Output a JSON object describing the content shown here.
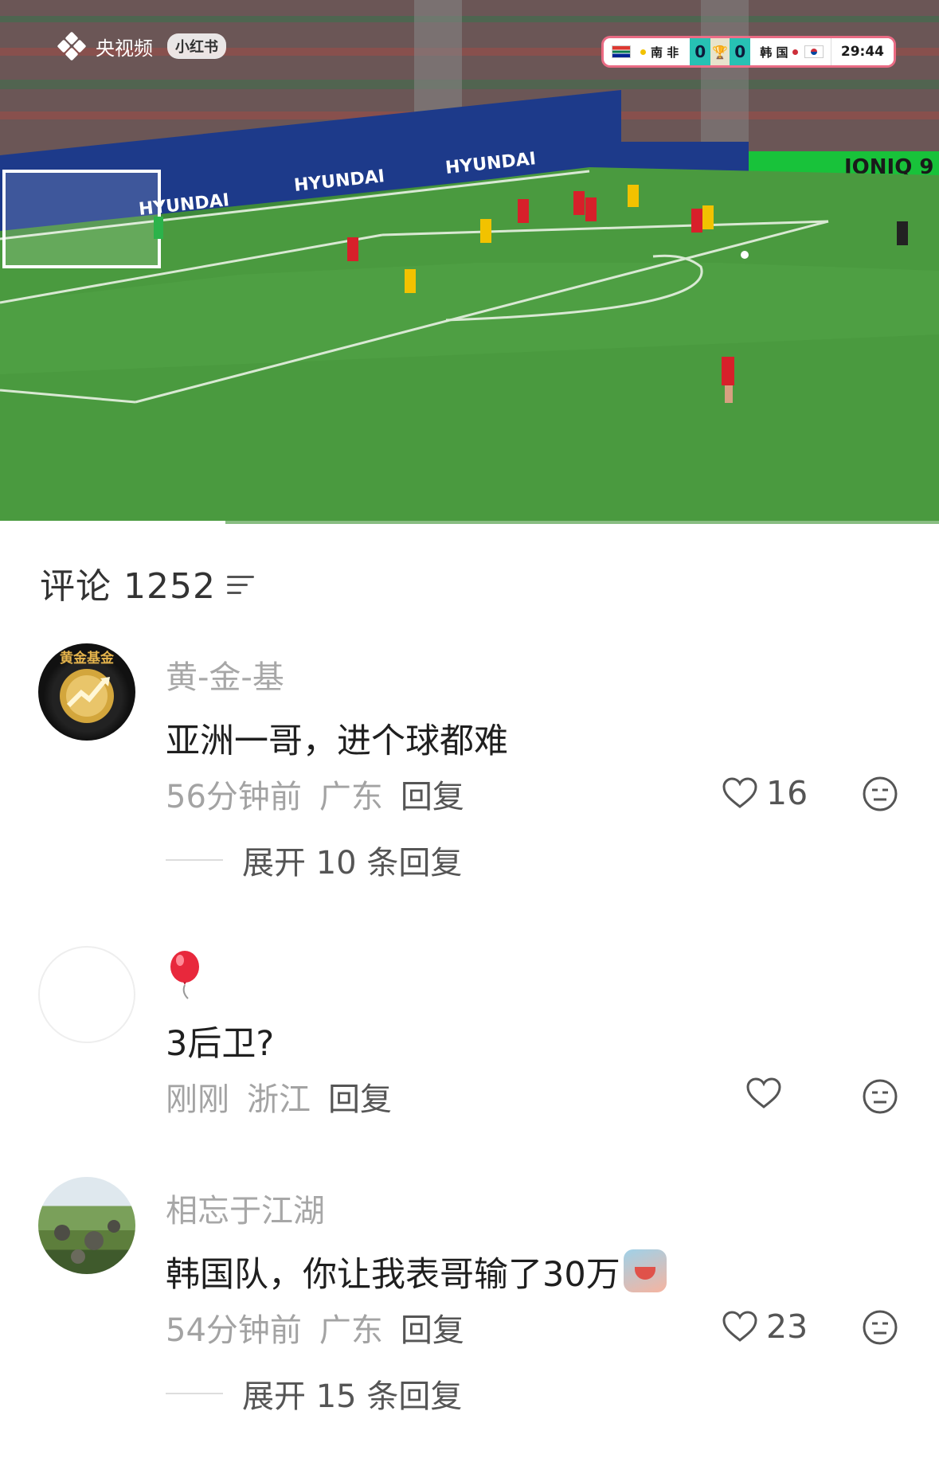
{
  "video": {
    "watermark_brand": "央视频",
    "watermark_app": "小红书",
    "ads": [
      "HYUNDAI",
      "HYUNDAI",
      "HYUNDAI",
      "IONIQ 9"
    ],
    "scoreboard": {
      "home_team": "南 非",
      "home_score": "0",
      "away_team": "韩 国",
      "away_score": "0",
      "clock": "29:44",
      "home_color": "#f2c200",
      "away_color": "#cd2e3a"
    },
    "progress": 0.24
  },
  "comments_header": {
    "title": "评论 1252"
  },
  "comments": [
    {
      "avatar_text": "黄金基金",
      "username": "黄-金-基",
      "text": "亚洲一哥，进个球都难",
      "time": "56分钟前",
      "location": "广东",
      "reply_label": "回复",
      "likes": "16",
      "expand_label": "展开 10 条回复"
    },
    {
      "username_icon": "balloon-icon",
      "text": "3后卫?",
      "time": "刚刚",
      "location": "浙江",
      "reply_label": "回复",
      "likes": ""
    },
    {
      "username": "相忘于江湖",
      "text": "韩国队，你让我表哥输了30万",
      "time": "54分钟前",
      "location": "广东",
      "reply_label": "回复",
      "likes": "23",
      "expand_label": "展开 15 条回复"
    }
  ]
}
